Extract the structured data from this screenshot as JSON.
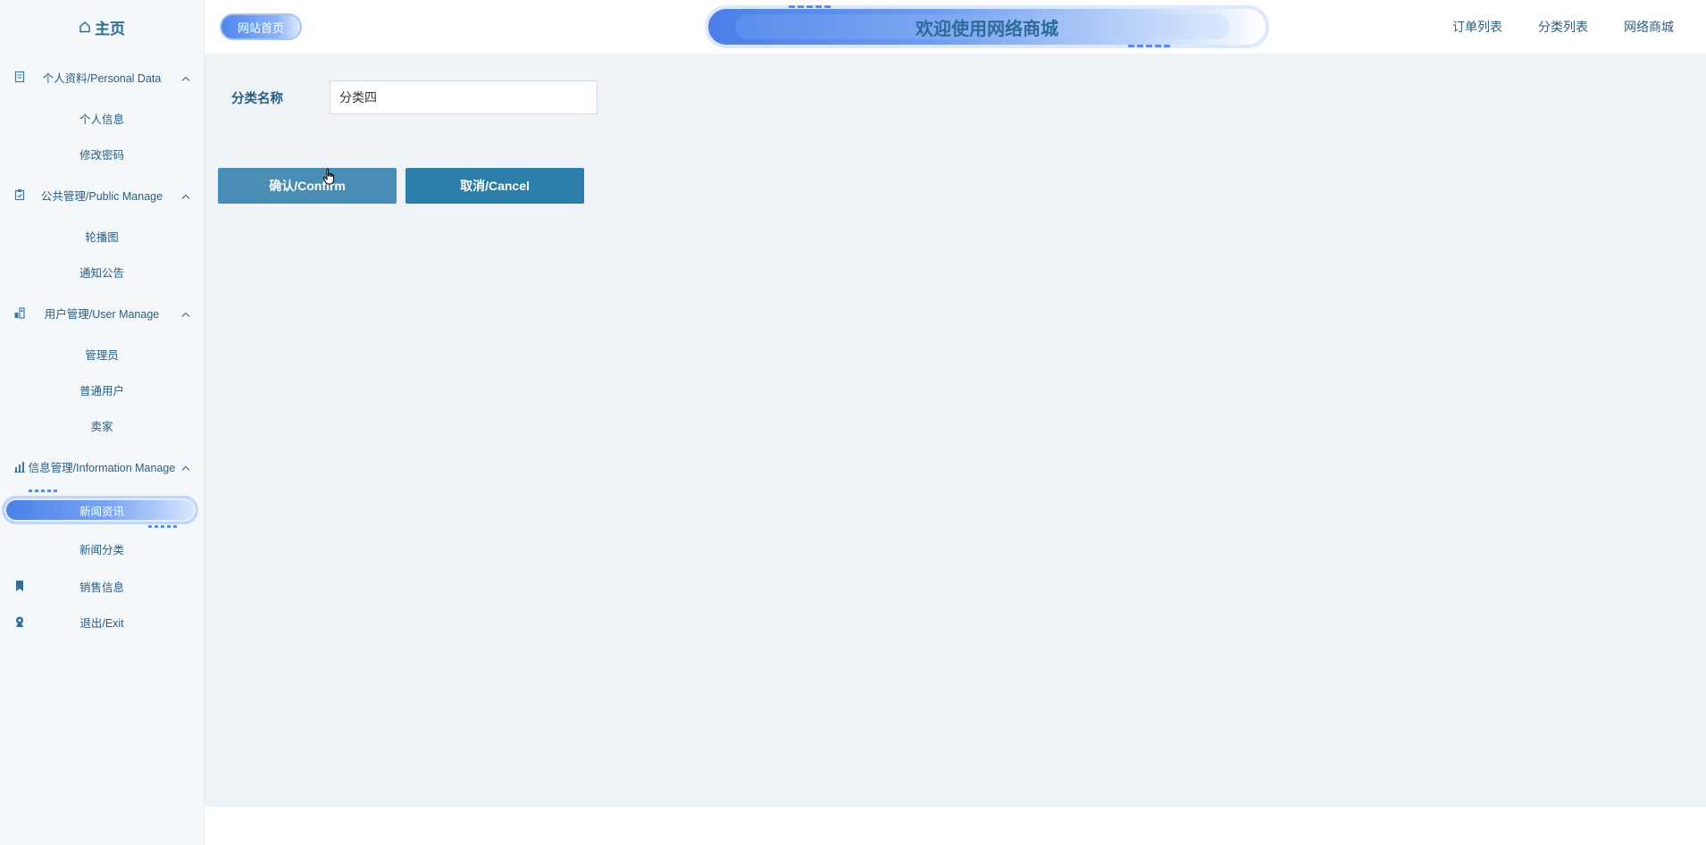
{
  "sidebar": {
    "home_label": "主页",
    "groups": [
      {
        "label": "个人资料/Personal Data",
        "icon": "document-icon",
        "items": [
          {
            "label": "个人信息"
          },
          {
            "label": "修改密码"
          }
        ]
      },
      {
        "label": "公共管理/Public Manage",
        "icon": "clipboard-icon",
        "items": [
          {
            "label": "轮播图"
          },
          {
            "label": "通知公告"
          }
        ]
      },
      {
        "label": "用户管理/User Manage",
        "icon": "users-building-icon",
        "items": [
          {
            "label": "管理员"
          },
          {
            "label": "普通用户"
          },
          {
            "label": "卖家"
          }
        ]
      },
      {
        "label": "信息管理/Information Manage",
        "icon": "chart-icon",
        "items": [
          {
            "label": "新闻资讯",
            "active": true
          },
          {
            "label": "新闻分类"
          }
        ]
      }
    ],
    "sales_label": "销售信息",
    "exit_label": "退出/Exit"
  },
  "topbar": {
    "home_link": "网站首页",
    "banner_title": "欢迎使用网络商城",
    "nav": [
      "订单列表",
      "分类列表",
      "网络商城"
    ]
  },
  "form": {
    "category_label": "分类名称",
    "category_value": "分类四",
    "confirm_label": "确认/Confirm",
    "cancel_label": "取消/Cancel"
  },
  "colors": {
    "accent": "#2c7da9",
    "confirm_bg": "#4a8db4",
    "text": "#2a5d80",
    "main_bg": "#eef3f7"
  }
}
